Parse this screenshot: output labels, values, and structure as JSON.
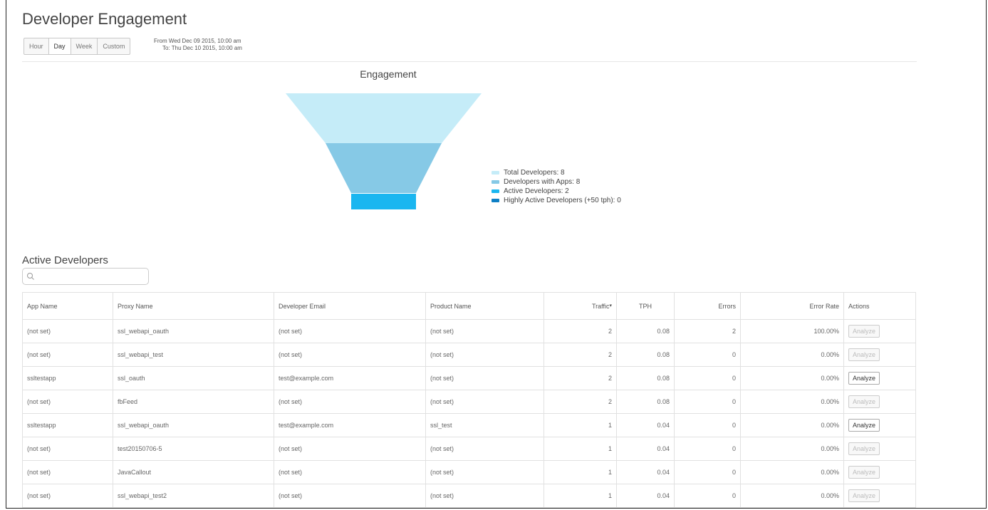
{
  "page": {
    "title": "Developer Engagement"
  },
  "range": {
    "buttons": [
      "Hour",
      "Day",
      "Week",
      "Custom"
    ],
    "selected": "Day",
    "from": "From Wed Dec 09 2015, 10:00 am",
    "to": "To: Thu Dec 10 2015, 10:00 am"
  },
  "funnel": {
    "title": "Engagement",
    "stages": [
      {
        "label": "Total Developers: 8",
        "value": 8,
        "color": "#c5ecf8"
      },
      {
        "label": "Developers with Apps: 8",
        "value": 8,
        "color": "#86c9e6"
      },
      {
        "label": "Active Developers: 2",
        "value": 2,
        "color": "#1ab6f0"
      },
      {
        "label": "Highly Active Developers (+50 tph): 0",
        "value": 0,
        "color": "#0e7fc5"
      }
    ]
  },
  "active_developers": {
    "title": "Active Developers",
    "search": {
      "placeholder": "",
      "value": "",
      "icon": "search-icon"
    },
    "columns": [
      "App Name",
      "Proxy Name",
      "Developer Email",
      "Product Name",
      "Traffic",
      "TPH",
      "Errors",
      "Error Rate",
      "Actions"
    ],
    "sort_indicator": "▾",
    "action_label": "Analyze",
    "rows": [
      {
        "app": "(not set)",
        "proxy": "ssl_webapi_oauth",
        "email": "(not set)",
        "product": "(not set)",
        "traffic": "2",
        "tph": "0.08",
        "errors": "2",
        "error_rate": "100.00%",
        "analyze_enabled": false
      },
      {
        "app": "(not set)",
        "proxy": "ssl_webapi_test",
        "email": "(not set)",
        "product": "(not set)",
        "traffic": "2",
        "tph": "0.08",
        "errors": "0",
        "error_rate": "0.00%",
        "analyze_enabled": false
      },
      {
        "app": "ssltestapp",
        "proxy": "ssl_oauth",
        "email": "test@example.com",
        "product": "(not set)",
        "traffic": "2",
        "tph": "0.08",
        "errors": "0",
        "error_rate": "0.00%",
        "analyze_enabled": true
      },
      {
        "app": "(not set)",
        "proxy": "fbFeed",
        "email": "(not set)",
        "product": "(not set)",
        "traffic": "2",
        "tph": "0.08",
        "errors": "0",
        "error_rate": "0.00%",
        "analyze_enabled": false
      },
      {
        "app": "ssltestapp",
        "proxy": "ssl_webapi_oauth",
        "email": "test@example.com",
        "product": "ssl_test",
        "traffic": "1",
        "tph": "0.04",
        "errors": "0",
        "error_rate": "0.00%",
        "analyze_enabled": true
      },
      {
        "app": "(not set)",
        "proxy": "test20150706-5",
        "email": "(not set)",
        "product": "(not set)",
        "traffic": "1",
        "tph": "0.04",
        "errors": "0",
        "error_rate": "0.00%",
        "analyze_enabled": false
      },
      {
        "app": "(not set)",
        "proxy": "JavaCallout",
        "email": "(not set)",
        "product": "(not set)",
        "traffic": "1",
        "tph": "0.04",
        "errors": "0",
        "error_rate": "0.00%",
        "analyze_enabled": false
      },
      {
        "app": "(not set)",
        "proxy": "ssl_webapi_test2",
        "email": "(not set)",
        "product": "(not set)",
        "traffic": "1",
        "tph": "0.04",
        "errors": "0",
        "error_rate": "0.00%",
        "analyze_enabled": false
      }
    ]
  }
}
